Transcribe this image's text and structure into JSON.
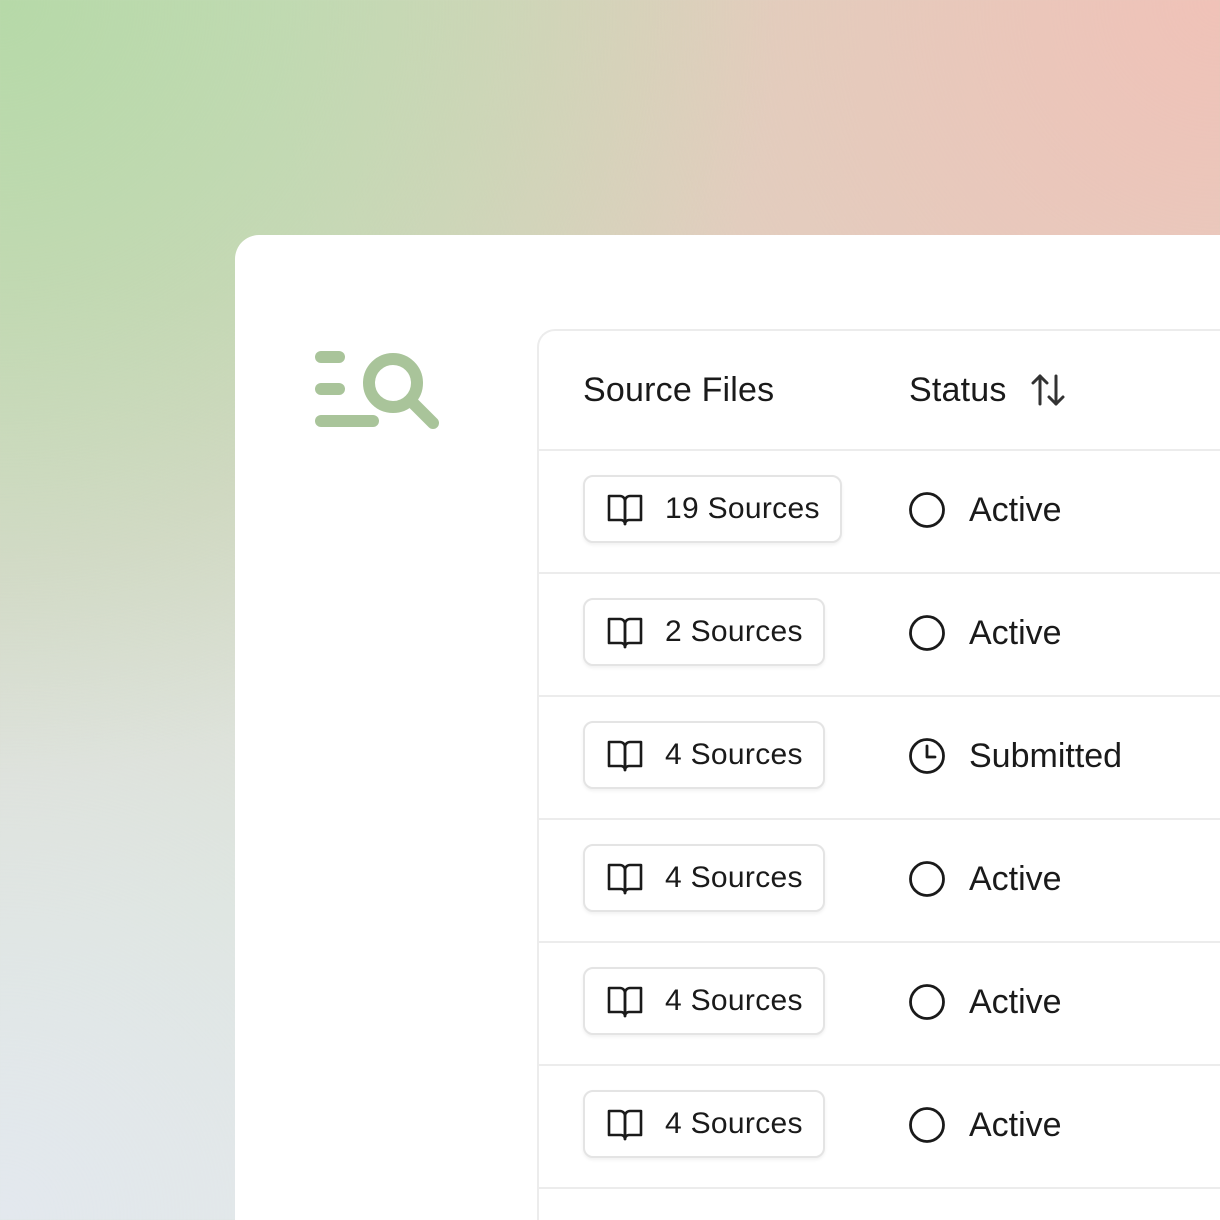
{
  "colors": {
    "accent": "#a9c49a",
    "text": "#1a1a1a",
    "border": "#ececec"
  },
  "logo": {
    "icon": "list-search-icon"
  },
  "table": {
    "headers": {
      "source_files": "Source Files",
      "status": "Status"
    },
    "sort_icon": "sort-arrows-icon",
    "rows": [
      {
        "sources": "19 Sources",
        "status": "Active",
        "status_icon": "circle-icon"
      },
      {
        "sources": "2 Sources",
        "status": "Active",
        "status_icon": "circle-icon"
      },
      {
        "sources": "4 Sources",
        "status": "Submitted",
        "status_icon": "clock-icon"
      },
      {
        "sources": "4 Sources",
        "status": "Active",
        "status_icon": "circle-icon"
      },
      {
        "sources": "4 Sources",
        "status": "Active",
        "status_icon": "circle-icon"
      },
      {
        "sources": "4 Sources",
        "status": "Active",
        "status_icon": "circle-icon"
      }
    ]
  }
}
